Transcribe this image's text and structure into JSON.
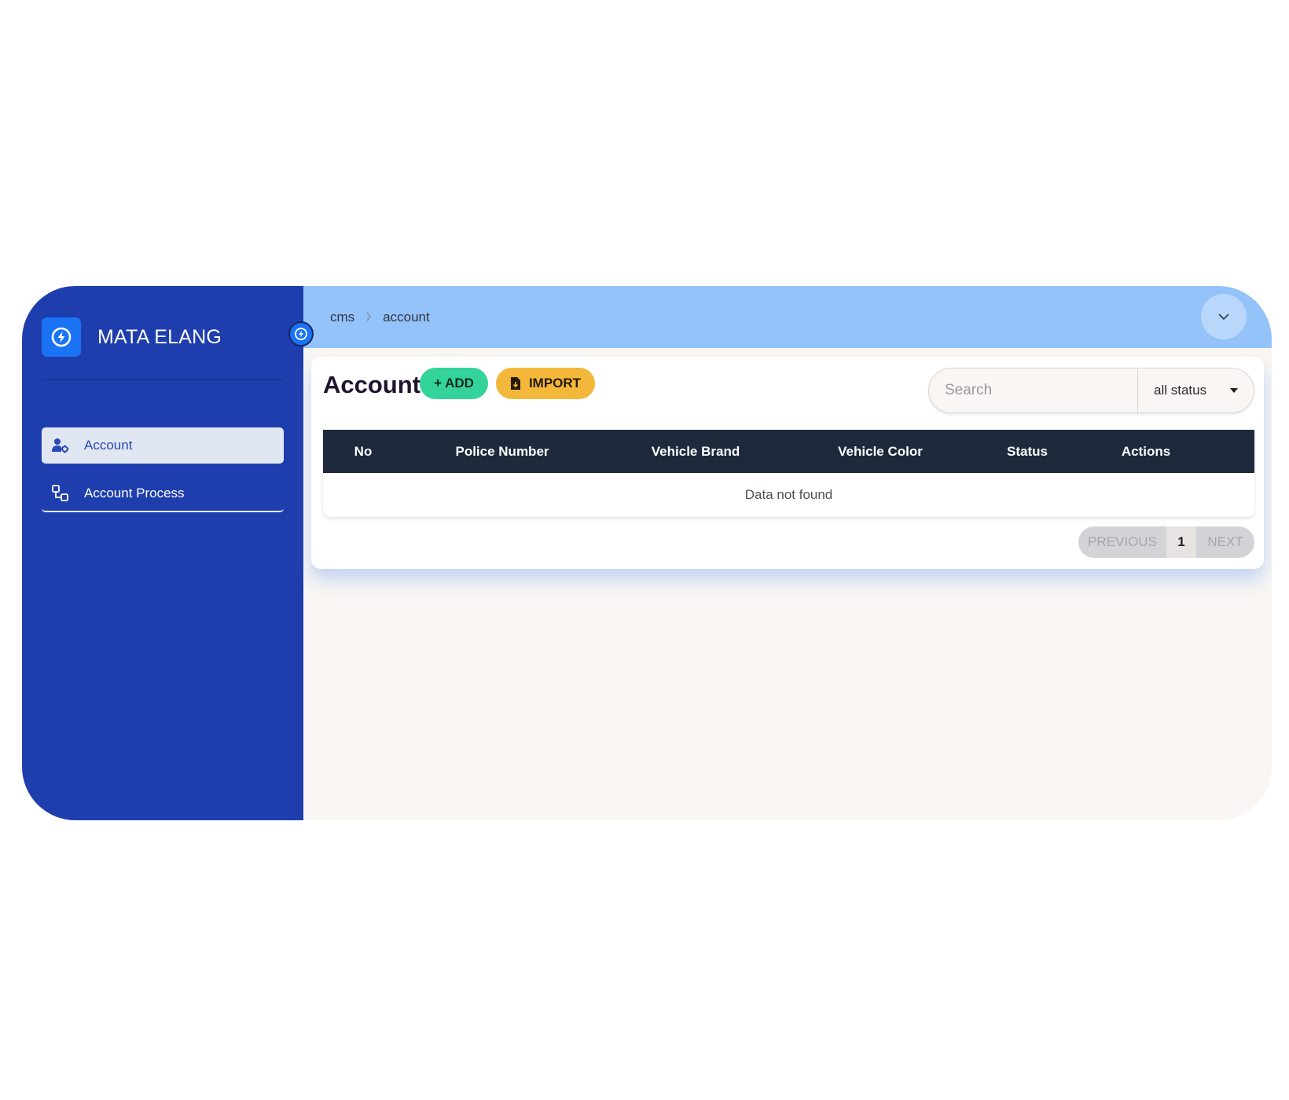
{
  "brand": {
    "name": "MATA ELANG",
    "logo_icon": "bolt-circle-icon",
    "accent": "#1a73f5"
  },
  "sidebar": {
    "background": "#1f3eae",
    "items": [
      {
        "label": "Account",
        "icon": "user-gear-icon",
        "active": true
      },
      {
        "label": "Account Process",
        "icon": "flow-nodes-icon",
        "active": false
      }
    ]
  },
  "breadcrumb": {
    "items": [
      "cms",
      "account"
    ]
  },
  "main": {
    "title": "Account",
    "add_label": "+ ADD",
    "import_label": "IMPORT",
    "search": {
      "placeholder": "Search",
      "value": ""
    },
    "status_filter": {
      "selected": "all status"
    },
    "table": {
      "columns": [
        "No",
        "Police Number",
        "Vehicle Brand",
        "Vehicle Color",
        "Status",
        "Actions"
      ],
      "rows": [],
      "empty_text": "Data not found"
    },
    "pagination": {
      "previous": "PREVIOUS",
      "current": "1",
      "next": "NEXT"
    }
  },
  "colors": {
    "topbar": "#94c3f9",
    "add_button": "#34d399",
    "import_button": "#f3b73a",
    "table_header": "#1e293b"
  }
}
